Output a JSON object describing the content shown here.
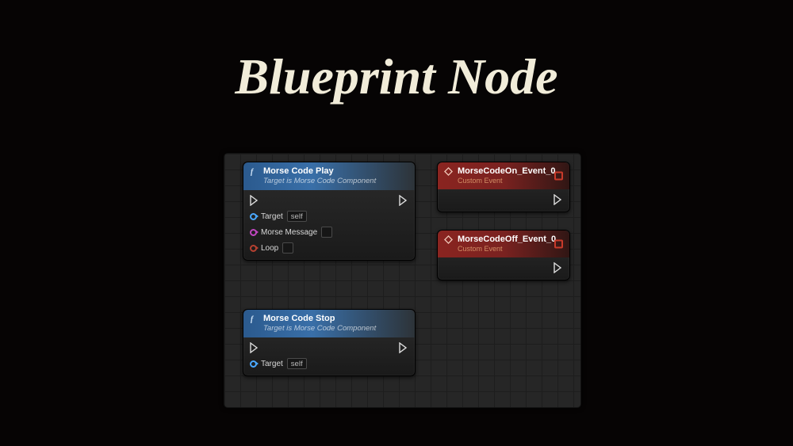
{
  "page": {
    "title": "Blueprint Node"
  },
  "nodes": {
    "play": {
      "title": "Morse Code Play",
      "subtitle": "Target is Morse Code Component",
      "pins": {
        "target_label": "Target",
        "target_value": "self",
        "message_label": "Morse Message",
        "message_value": "",
        "loop_label": "Loop",
        "loop_value": ""
      }
    },
    "stop": {
      "title": "Morse Code Stop",
      "subtitle": "Target is Morse Code Component",
      "pins": {
        "target_label": "Target",
        "target_value": "self"
      }
    },
    "on_event": {
      "title": "MorseCodeOn_Event_0",
      "subtitle": "Custom Event"
    },
    "off_event": {
      "title": "MorseCodeOff_Event_0",
      "subtitle": "Custom Event"
    }
  }
}
